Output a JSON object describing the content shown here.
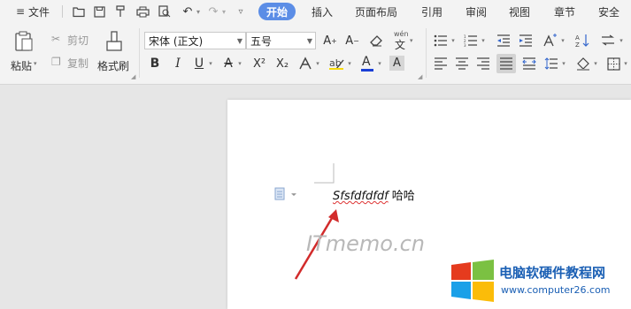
{
  "menu": {
    "label": "文件"
  },
  "tabs": [
    "开始",
    "插入",
    "页面布局",
    "引用",
    "审阅",
    "视图",
    "章节",
    "安全"
  ],
  "clipboard": {
    "paste": "粘贴",
    "cut": "剪切",
    "copy": "复制",
    "format_painter": "格式刷"
  },
  "font": {
    "name": "宋体 (正文)",
    "size": "五号"
  },
  "format": {
    "bold": "B",
    "italic": "I",
    "underline": "U",
    "strike": "A",
    "superscript": "X²",
    "subscript": "X₂",
    "font_color": "A",
    "char_shade": "A",
    "font_effect": "A",
    "phonetic": "wén"
  },
  "document": {
    "italic_text": "Sfsfdfdfdf",
    "plain_text": " 哈哈"
  },
  "watermark": "ITmemo.cn",
  "brand": {
    "name": "电脑软硬件教程网",
    "url": "www.computer26.com"
  },
  "colors": {
    "accent": "#5b8de6",
    "arrow": "#d22b2b",
    "font_color_bar": "#1a3fd6"
  }
}
